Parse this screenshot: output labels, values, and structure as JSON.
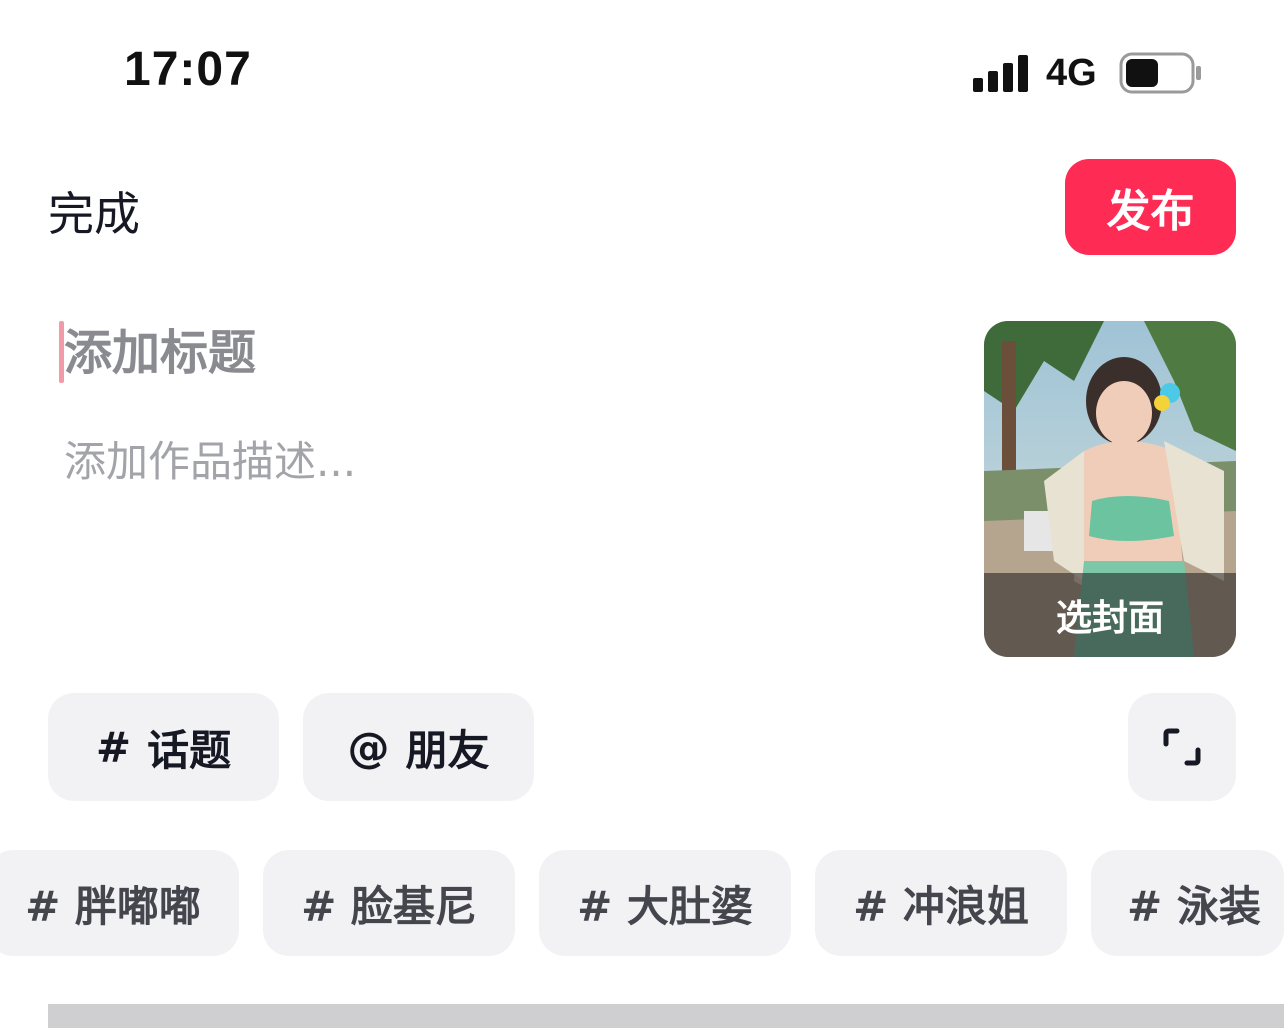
{
  "status_bar": {
    "time": "17:07",
    "network": "4G",
    "icons": [
      "signal-icon",
      "battery-icon"
    ]
  },
  "header": {
    "done_label": "完成",
    "publish_label": "发布",
    "publish_color": "#fe2c55"
  },
  "editor": {
    "title_placeholder": "添加标题",
    "title_value": "",
    "description_placeholder": "添加作品描述...",
    "description_value": ""
  },
  "cover": {
    "label": "选封面"
  },
  "actions": {
    "topic_symbol": "#",
    "topic_label": "话题",
    "friend_symbol": "@",
    "friend_label": "朋友",
    "expand_icon": "expand-icon"
  },
  "suggested_tags": [
    "# 胖嘟嘟",
    "# 脸基尼",
    "# 大肚婆",
    "# 冲浪姐",
    "# 泳装"
  ]
}
